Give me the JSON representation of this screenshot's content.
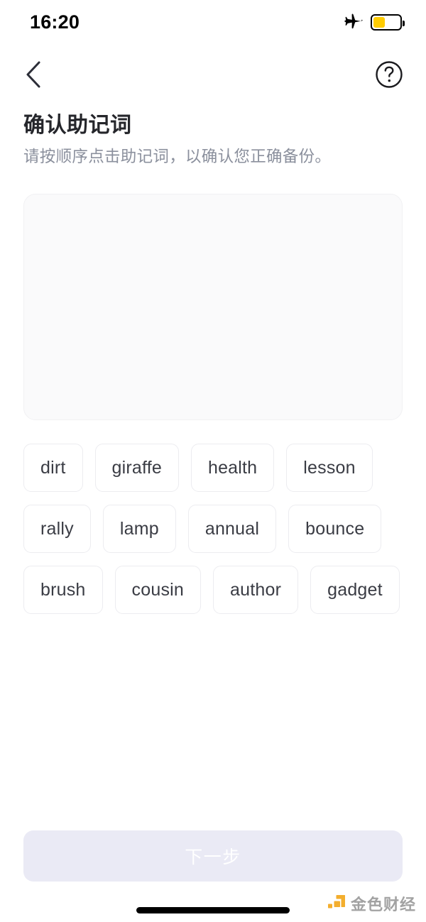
{
  "status_bar": {
    "time": "16:20",
    "airplane_icon": "airplane-mode-icon",
    "battery": {
      "icon": "battery-icon",
      "level_percent": 45,
      "color": "#FFCC00"
    }
  },
  "nav_bar": {
    "back_icon": "chevron-left-icon",
    "help_icon": "question-mark-circle-icon"
  },
  "heading": {
    "title": "确认助记词",
    "subtitle": "请按顺序点击助记词，以确认您正确备份。"
  },
  "selection_area": {
    "name": "selected-words-dropzone",
    "selected_words": [],
    "background_color": "#FAFAFB",
    "border_color": "#F1F1F3"
  },
  "word_bank": {
    "words": [
      "dirt",
      "giraffe",
      "health",
      "lesson",
      "rally",
      "lamp",
      "annual",
      "bounce",
      "brush",
      "cousin",
      "author",
      "gadget"
    ],
    "count": 12
  },
  "footer": {
    "next_button_label": "下一步",
    "next_button_enabled": false,
    "next_button_color": "#EAEAF5"
  },
  "watermark": {
    "text": "金色财经",
    "logo_icon": "jinse-logo-icon",
    "logo_color": "#F2A81D"
  },
  "colors": {
    "title": "#25262B",
    "subtitle": "#8B909D",
    "chip_text": "#3A3C44",
    "chip_border": "#ECECF0"
  }
}
